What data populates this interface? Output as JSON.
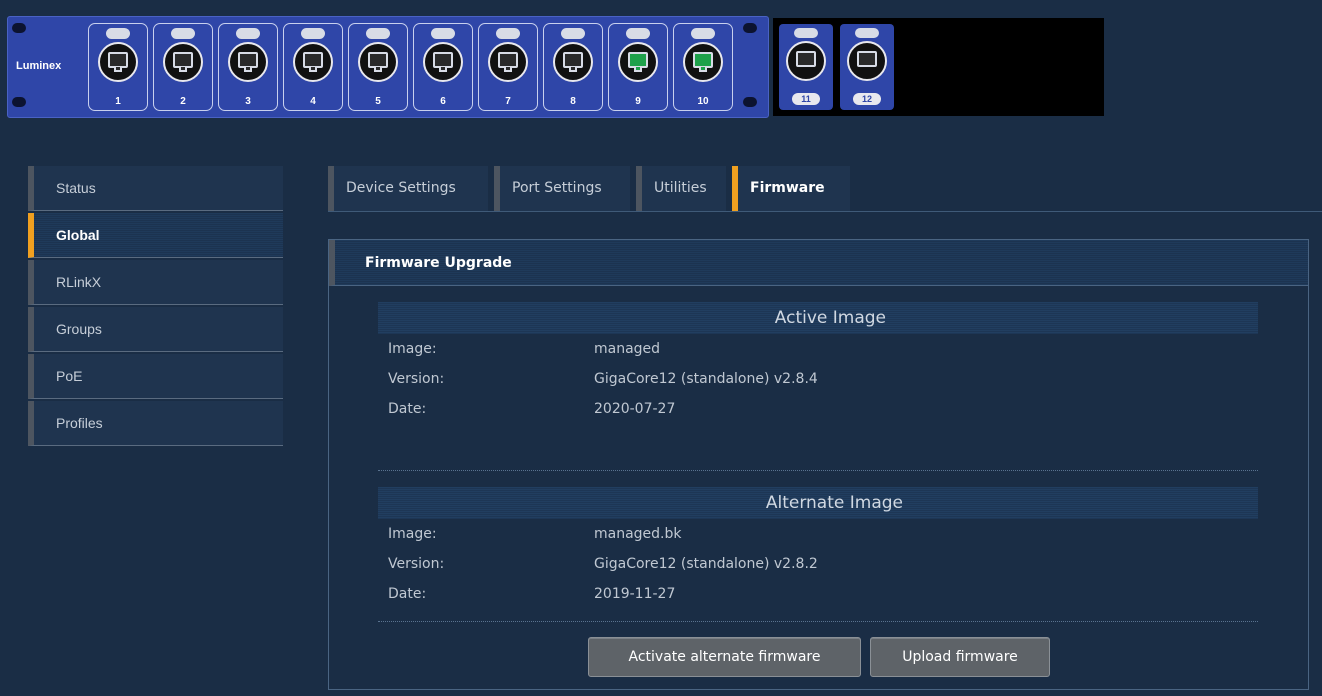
{
  "device": {
    "brand": "Luminex",
    "ports": [
      {
        "label": "1",
        "state": "off"
      },
      {
        "label": "2",
        "state": "off"
      },
      {
        "label": "3",
        "state": "off"
      },
      {
        "label": "4",
        "state": "off"
      },
      {
        "label": "5",
        "state": "off"
      },
      {
        "label": "6",
        "state": "off"
      },
      {
        "label": "7",
        "state": "off"
      },
      {
        "label": "8",
        "state": "off"
      },
      {
        "label": "9",
        "state": "active"
      },
      {
        "label": "10",
        "state": "active"
      }
    ],
    "sfp_ports": [
      {
        "label": "11"
      },
      {
        "label": "12"
      }
    ],
    "active_port_color": "#1ea14a",
    "panel_color": "#2f46a8"
  },
  "sidebar": {
    "items": [
      {
        "label": "Status"
      },
      {
        "label": "Global"
      },
      {
        "label": "RLinkX"
      },
      {
        "label": "Groups"
      },
      {
        "label": "PoE"
      },
      {
        "label": "Profiles"
      }
    ],
    "active": "Global"
  },
  "tabs": {
    "items": [
      {
        "label": "Device Settings"
      },
      {
        "label": "Port Settings"
      },
      {
        "label": "Utilities"
      },
      {
        "label": "Firmware"
      }
    ],
    "active": "Firmware",
    "accent_color": "#f0a020"
  },
  "firmware": {
    "panel_title": "Firmware Upgrade",
    "active_image": {
      "title": "Active Image",
      "rows": [
        {
          "key": "Image:",
          "value": "managed"
        },
        {
          "key": "Version:",
          "value": "GigaCore12 (standalone) v2.8.4"
        },
        {
          "key": "Date:",
          "value": "2020-07-27"
        }
      ]
    },
    "alternate_image": {
      "title": "Alternate Image",
      "rows": [
        {
          "key": "Image:",
          "value": "managed.bk"
        },
        {
          "key": "Version:",
          "value": "GigaCore12 (standalone) v2.8.2"
        },
        {
          "key": "Date:",
          "value": "2019-11-27"
        }
      ]
    },
    "activate_button": "Activate alternate firmware",
    "upload_button": "Upload firmware"
  }
}
